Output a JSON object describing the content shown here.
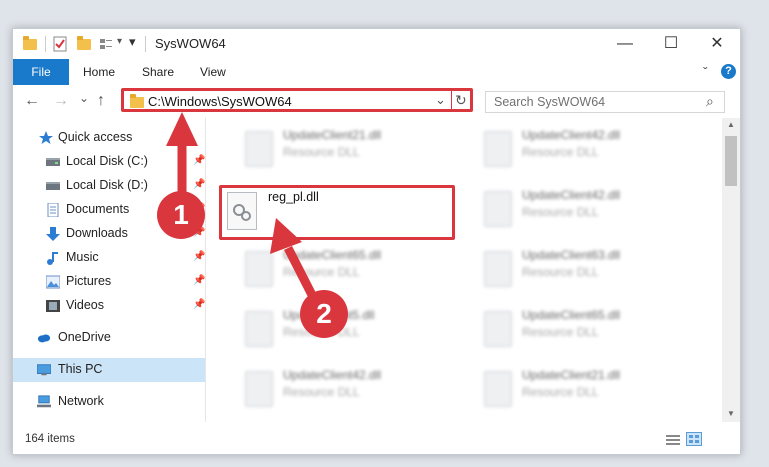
{
  "window": {
    "title": "SysWOW64",
    "minimize": "—",
    "maximize": "☐",
    "close": "✕"
  },
  "ribbon": {
    "file": "File",
    "tabs": [
      "Home",
      "Share",
      "View"
    ],
    "collapse": "ˇ",
    "help": "?"
  },
  "nav": {
    "back": "←",
    "forward": "→",
    "recent": "⌄",
    "up": "↑",
    "address": "C:\\Windows\\SysWOW64",
    "address_dropdown": "⌄",
    "refresh": "↻",
    "search_placeholder": "Search SysWOW64",
    "search_icon": "⌕"
  },
  "sidebar": {
    "items": [
      {
        "label": "Quick access",
        "icon": "star-icon"
      },
      {
        "label": "Local Disk (C:)",
        "icon": "drive-icon"
      },
      {
        "label": "Local Disk (D:)",
        "icon": "drive-icon"
      },
      {
        "label": "Documents",
        "icon": "documents-icon"
      },
      {
        "label": "Downloads",
        "icon": "download-icon"
      },
      {
        "label": "Music",
        "icon": "music-icon"
      },
      {
        "label": "Pictures",
        "icon": "pictures-icon"
      },
      {
        "label": "Videos",
        "icon": "videos-icon"
      },
      {
        "label": "OneDrive",
        "icon": "cloud-icon"
      },
      {
        "label": "This PC",
        "icon": "computer-icon"
      },
      {
        "label": "Network",
        "icon": "network-icon"
      }
    ]
  },
  "files": [
    {
      "name": "UpdateClient21.dll",
      "desc": "Resource DLL"
    },
    {
      "name": "UpdateClient42.dll",
      "desc": "Resource DLL"
    },
    {
      "name": "UpdateClient42.dll",
      "desc": "Resource DLL"
    },
    {
      "name": "UpdateClient65.dll",
      "desc": "Resource DLL"
    },
    {
      "name": "UpdateClient63.dll",
      "desc": "Resource DLL"
    },
    {
      "name": "UpdateClient5.dll",
      "desc": "Resource DLL"
    },
    {
      "name": "UpdateClient65.dll",
      "desc": "Resource DLL"
    },
    {
      "name": "UpdateClient42.dll",
      "desc": "Resource DLL"
    },
    {
      "name": "UpdateClient21.dll",
      "desc": "Resource DLL"
    }
  ],
  "highlighted_file": {
    "name": "reg_pl.dll"
  },
  "callouts": [
    "1",
    "2"
  ],
  "status": {
    "item_count": "164 items"
  },
  "colors": {
    "accent": "#1979ca",
    "highlight": "#d9363e",
    "selected": "#cce4f7"
  }
}
